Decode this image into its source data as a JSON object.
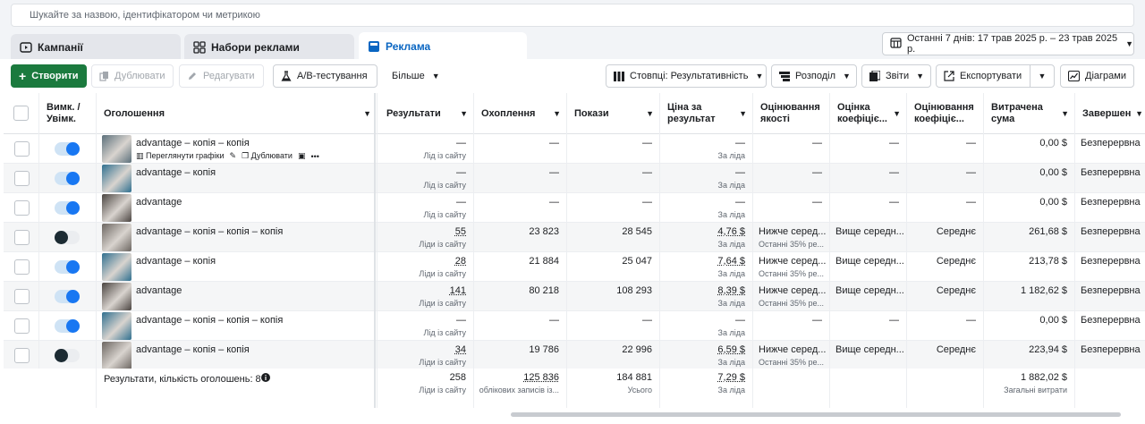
{
  "search": {
    "placeholder": "Шукайте за назвою, ідентифікатором чи метрикою"
  },
  "tabs": [
    {
      "label": "Кампанії",
      "icon": "folder-icon"
    },
    {
      "label": "Набори реклами",
      "icon": "grid-icon"
    },
    {
      "label": "Реклама",
      "icon": "ad-icon"
    }
  ],
  "date_range": "Останні 7 днів: 17 трав 2025 р. – 23 трав 2025 р.",
  "toolbar": {
    "create": "Створити",
    "duplicate": "Дублювати",
    "edit": "Редагувати",
    "ab_test": "A/B-тестування",
    "more": "Більше",
    "columns": "Стовпці: Результативність",
    "breakdown": "Розподіл",
    "reports": "Звіти",
    "export": "Експортувати",
    "charts": "Діаграми"
  },
  "columns": {
    "onoff": "Вимк. / Увімк.",
    "ad": "Оголошення",
    "results": "Результати",
    "reach": "Охоплення",
    "impressions": "Покази",
    "cpr": "Ціна за результат",
    "quality": "Оцінювання якості",
    "engagement": "Оцінка коефіціє...",
    "conversion": "Оцінювання коефіціє...",
    "spent": "Витрачена сума",
    "ends": "Завершен"
  },
  "row_actions": {
    "view_charts": "Переглянути графіки",
    "duplicate": "Дублювати"
  },
  "rows": [
    {
      "name": "advantage – копія – копія",
      "on": true,
      "results": "—",
      "results_sub": "Лід із сайту",
      "reach": "—",
      "impressions": "—",
      "cpr": "—",
      "cpr_sub": "За ліда",
      "quality": "—",
      "quality_sub": "",
      "engagement": "—",
      "conversion": "—",
      "spent": "0,00 $",
      "ends": "Безперервна",
      "thumb": "#5b6f7a"
    },
    {
      "name": "advantage – копія",
      "on": true,
      "results": "—",
      "results_sub": "Лід із сайту",
      "reach": "—",
      "impressions": "—",
      "cpr": "—",
      "cpr_sub": "За ліда",
      "quality": "—",
      "quality_sub": "",
      "engagement": "—",
      "conversion": "—",
      "spent": "0,00 $",
      "ends": "Безперервна",
      "thumb": "#2f6f8f"
    },
    {
      "name": "advantage",
      "on": true,
      "results": "—",
      "results_sub": "Лід із сайту",
      "reach": "—",
      "impressions": "—",
      "cpr": "—",
      "cpr_sub": "За ліда",
      "quality": "—",
      "quality_sub": "",
      "engagement": "—",
      "conversion": "—",
      "spent": "0,00 $",
      "ends": "Безперервна",
      "thumb": "#4a4440"
    },
    {
      "name": "advantage – копія – копія – копія",
      "on": false,
      "results": "55",
      "results_sub": "Ліди із сайту",
      "reach": "23 823",
      "impressions": "28 545",
      "cpr": "4,76 $",
      "cpr_sub": "За ліда",
      "quality": "Нижче серед...",
      "quality_sub": "Останні 35% ре...",
      "engagement": "Вище середн...",
      "conversion": "Середнє",
      "spent": "261,68 $",
      "ends": "Безперервна",
      "thumb": "#6b6560"
    },
    {
      "name": "advantage – копія",
      "on": true,
      "results": "28",
      "results_sub": "Ліди із сайту",
      "reach": "21 884",
      "impressions": "25 047",
      "cpr": "7,64 $",
      "cpr_sub": "За ліда",
      "quality": "Нижче серед...",
      "quality_sub": "Останні 35% ре...",
      "engagement": "Вище середн...",
      "conversion": "Середнє",
      "spent": "213,78 $",
      "ends": "Безперервна",
      "thumb": "#2f6f8f"
    },
    {
      "name": "advantage",
      "on": true,
      "results": "141",
      "results_sub": "Ліди із сайту",
      "reach": "80 218",
      "impressions": "108 293",
      "cpr": "8,39 $",
      "cpr_sub": "За ліда",
      "quality": "Нижче серед...",
      "quality_sub": "Останні 35% ре...",
      "engagement": "Вище середн...",
      "conversion": "Середнє",
      "spent": "1 182,62 $",
      "ends": "Безперервна",
      "thumb": "#4a4440"
    },
    {
      "name": "advantage – копія – копія – копія",
      "on": true,
      "results": "—",
      "results_sub": "Лід із сайту",
      "reach": "—",
      "impressions": "—",
      "cpr": "—",
      "cpr_sub": "За ліда",
      "quality": "—",
      "quality_sub": "",
      "engagement": "—",
      "conversion": "—",
      "spent": "0,00 $",
      "ends": "Безперервна",
      "thumb": "#2f6f8f"
    },
    {
      "name": "advantage – копія – копія",
      "on": false,
      "results": "34",
      "results_sub": "Ліди із сайту",
      "reach": "19 786",
      "impressions": "22 996",
      "cpr": "6,59 $",
      "cpr_sub": "За ліда",
      "quality": "Нижче серед...",
      "quality_sub": "Останні 35% ре...",
      "engagement": "Вище середн...",
      "conversion": "Середнє",
      "spent": "223,94 $",
      "ends": "Безперервна",
      "thumb": "#6b6560"
    }
  ],
  "footer": {
    "label": "Результати, кількість оголошень: 8",
    "results": "258",
    "results_sub": "Ліди із сайту",
    "reach": "125 836",
    "reach_sub": "облікових записів із...",
    "impressions": "184 881",
    "impressions_sub": "Усього",
    "cpr": "7,29 $",
    "cpr_sub": "За ліда",
    "spent": "1 882,02 $",
    "spent_sub": "Загальні витрати"
  },
  "colors": {
    "accent": "#1877f2",
    "create": "#1b7a3e",
    "active_tab": "#0a66c2"
  }
}
